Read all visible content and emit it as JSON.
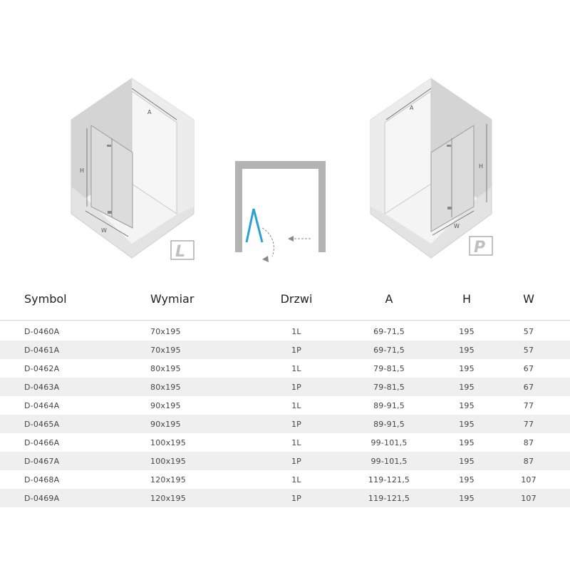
{
  "figures": {
    "left_cabin": {
      "badge": "L",
      "dim_a": "A",
      "dim_h": "H",
      "dim_w": "W"
    },
    "right_cabin": {
      "badge": "P",
      "dim_a": "A",
      "dim_h": "H",
      "dim_w": "W"
    }
  },
  "table": {
    "headers": [
      "Symbol",
      "Wymiar",
      "Drzwi",
      "A",
      "H",
      "W"
    ],
    "rows": [
      [
        "D-0460A",
        "70x195",
        "1L",
        "69-71,5",
        "195",
        "57"
      ],
      [
        "D-0461A",
        "70x195",
        "1P",
        "69-71,5",
        "195",
        "57"
      ],
      [
        "D-0462A",
        "80x195",
        "1L",
        "79-81,5",
        "195",
        "67"
      ],
      [
        "D-0463A",
        "80x195",
        "1P",
        "79-81,5",
        "195",
        "67"
      ],
      [
        "D-0464A",
        "90x195",
        "1L",
        "89-91,5",
        "195",
        "77"
      ],
      [
        "D-0465A",
        "90x195",
        "1P",
        "89-91,5",
        "195",
        "77"
      ],
      [
        "D-0466A",
        "100x195",
        "1L",
        "99-101,5",
        "195",
        "87"
      ],
      [
        "D-0467A",
        "100x195",
        "1P",
        "99-101,5",
        "195",
        "87"
      ],
      [
        "D-0468A",
        "120x195",
        "1L",
        "119-121,5",
        "195",
        "107"
      ],
      [
        "D-0469A",
        "120x195",
        "1P",
        "119-121,5",
        "195",
        "107"
      ]
    ]
  },
  "colors": {
    "door_blue": "#2aa0d8",
    "stripe": "#efefef",
    "wall": "#d9d9d9"
  }
}
